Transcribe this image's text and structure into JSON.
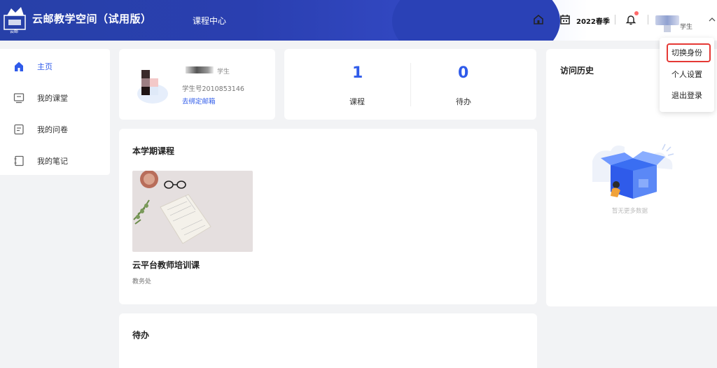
{
  "header": {
    "app_title": "云邮教学空间（试用版）",
    "logo_caption": "云邮",
    "nav_course_center": "课程中心",
    "season": "2022春季",
    "role": "学生",
    "notification_dot_color": "#ff6a6a",
    "icons": [
      "home-icon",
      "calendar-icon",
      "bell-icon",
      "chevron-up-icon"
    ]
  },
  "sidebar": {
    "items": [
      {
        "label": "主页",
        "icon": "home-icon",
        "active": true
      },
      {
        "label": "我的课堂",
        "icon": "classroom-icon",
        "active": false
      },
      {
        "label": "我的问卷",
        "icon": "survey-icon",
        "active": false
      },
      {
        "label": "我的笔记",
        "icon": "notebook-icon",
        "active": false
      }
    ]
  },
  "profile": {
    "role": "学生",
    "student_id": "学生号2010853146",
    "bind_email": "去绑定邮箱"
  },
  "stats": {
    "courses_value": "1",
    "courses_label": "课程",
    "todo_value": "0",
    "todo_label": "待办"
  },
  "semester": {
    "title": "本学期课程",
    "course": {
      "name": "云平台教师培训课",
      "department": "教务处"
    }
  },
  "todo": {
    "title": "待办"
  },
  "history": {
    "title": "访问历史",
    "empty_text": "暂无更多数据"
  },
  "dropdown": {
    "items": [
      "切换身份",
      "个人设置",
      "退出登录"
    ],
    "highlight_color": "#e53935"
  },
  "colors": {
    "accent": "#2f5bea",
    "header_blue": "#2a3fb0",
    "background": "#f2f3f5"
  }
}
